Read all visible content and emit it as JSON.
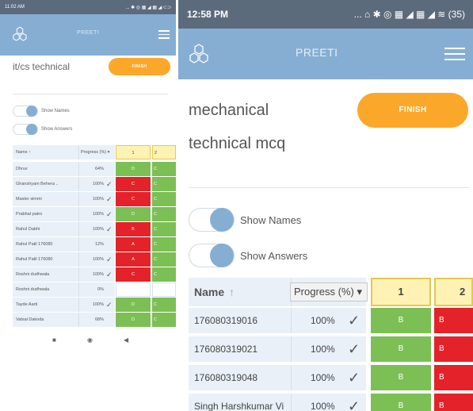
{
  "left": {
    "status": {
      "time": "11:02 AM",
      "icons": "... ✱ ◎ ▦ ◢ ▦ ◢ ⊂⊃"
    },
    "app": {
      "brand": "PREETI"
    },
    "title": "it/cs technical",
    "finish_label": "FINISH",
    "toggles": {
      "show_names": "Show Names",
      "show_answers": "Show Answers"
    },
    "table": {
      "head": {
        "name": "Name ↑",
        "progress": "Progress (%) ▾",
        "q1": "1",
        "q2": "2"
      },
      "rows": [
        {
          "name": "Dhruv",
          "progress": "64%",
          "check": "",
          "a1": "D",
          "a2": "C",
          "s1": "green",
          "s2": "green"
        },
        {
          "name": "Ghanshyam Behera ..",
          "progress": "100%",
          "check": "✓",
          "a1": "C",
          "a2": "C",
          "s1": "red",
          "s2": "green"
        },
        {
          "name": "Master simmi",
          "progress": "100%",
          "check": "✓",
          "a1": "C",
          "a2": "C",
          "s1": "red",
          "s2": "green"
        },
        {
          "name": "Prabhat patro",
          "progress": "100%",
          "check": "✓",
          "a1": "D",
          "a2": "C",
          "s1": "green",
          "s2": "green"
        },
        {
          "name": "Rahul Dabhi",
          "progress": "100%",
          "check": "✓",
          "a1": "B",
          "a2": "C",
          "s1": "red",
          "s2": "green"
        },
        {
          "name": "Rahul Patil 176080",
          "progress": "12%",
          "check": "",
          "a1": "A",
          "a2": "C",
          "s1": "red",
          "s2": "green"
        },
        {
          "name": "Rahul Patil 176080",
          "progress": "100%",
          "check": "✓",
          "a1": "A",
          "a2": "C",
          "s1": "red",
          "s2": "green"
        },
        {
          "name": "Roshni dudhwala",
          "progress": "100%",
          "check": "✓",
          "a1": "C",
          "a2": "C",
          "s1": "red",
          "s2": "green"
        },
        {
          "name": "Roshni dudhwala",
          "progress": "0%",
          "check": "",
          "a1": "",
          "a2": "",
          "s1": "empty",
          "s2": "empty"
        },
        {
          "name": "Tayde Aarti",
          "progress": "100%",
          "check": "✓",
          "a1": "D",
          "a2": "C",
          "s1": "green",
          "s2": "green"
        },
        {
          "name": "Vatsal Dakoda",
          "progress": "68%",
          "check": "",
          "a1": "D",
          "a2": "C",
          "s1": "green",
          "s2": "green"
        }
      ]
    },
    "nav": {
      "recent": "■",
      "home": "◉",
      "back": "◀"
    }
  },
  "right": {
    "status": {
      "time": "12:58 PM",
      "icons": "... ⌂ ✱ ◎ ▦ ◢ ▦ ◢ ≋ (35)"
    },
    "app": {
      "brand": "PREETI"
    },
    "title_line1": "mechanical",
    "title_line2": "technical mcq",
    "finish_label": "FINISH",
    "toggles": {
      "show_names": "Show Names",
      "show_answers": "Show Answers"
    },
    "table": {
      "head": {
        "name": "Name",
        "sort_arrow": "↑",
        "progress": "Progress (%) ▾",
        "q1": "1",
        "q2": "2"
      },
      "rows": [
        {
          "name": "176080319016",
          "progress": "100%",
          "check": "✓",
          "a1": "B",
          "a2": "B",
          "s1": "green",
          "s2": "red"
        },
        {
          "name": "176080319021",
          "progress": "100%",
          "check": "✓",
          "a1": "B",
          "a2": "B",
          "s1": "green",
          "s2": "red"
        },
        {
          "name": "176080319048",
          "progress": "100%",
          "check": "✓",
          "a1": "B",
          "a2": "B",
          "s1": "green",
          "s2": "red"
        },
        {
          "name": "Singh Harshkumar Vi",
          "progress": "100%",
          "check": "✓",
          "a1": "B",
          "a2": "B",
          "s1": "green",
          "s2": "red"
        }
      ]
    }
  },
  "colors": {
    "status_bar": "#5c6b7c",
    "app_bar": "#86aed3",
    "accent_orange": "#fba82a",
    "correct": "#7cbf55",
    "wrong": "#e3222a",
    "header_cell": "#fff2b5"
  }
}
